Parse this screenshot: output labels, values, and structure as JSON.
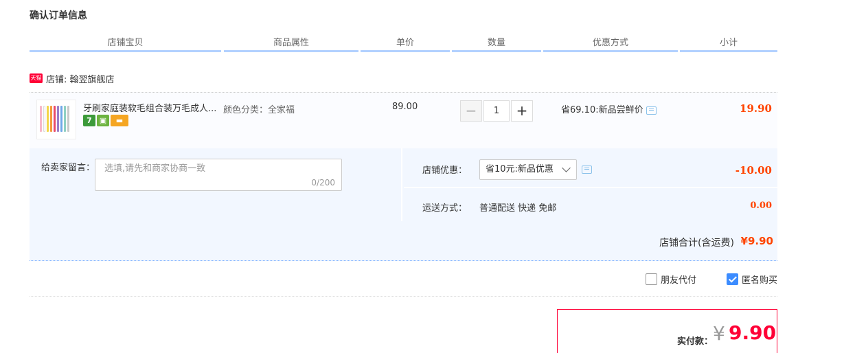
{
  "section_title": "确认订单信息",
  "columns": [
    "店铺宝贝",
    "商品属性",
    "单价",
    "数量",
    "优惠方式",
    "小计"
  ],
  "shop": {
    "badge": "天猫",
    "label": "店铺: 翰翌旗舰店"
  },
  "item": {
    "title": "牙刷家庭装软毛组合装万毛成人...",
    "icons": [
      "seven-day-return-icon",
      "shop-icon",
      "card-icon"
    ],
    "attribute": "颜色分类：全家福",
    "price": "89.00",
    "quantity": "1",
    "promo": "省69.10:新品尝鲜价",
    "subtotal": "19.90",
    "colors": {
      "accent_red": "#ff4400",
      "header_underline": "#b2d1ff",
      "panel_bg": "#f2f7ff"
    }
  },
  "memo": {
    "label": "给卖家留言：",
    "placeholder": "选填,请先和商家协商一致",
    "count": "0/200"
  },
  "coupon": {
    "label": "店铺优惠：",
    "selected": "省10元:新品优惠",
    "amount": "-10.00"
  },
  "shipping": {
    "label": "运送方式：",
    "value": "普通配送 快递 免邮",
    "amount": "0.00"
  },
  "shop_total": {
    "label": "店铺合计(含运费)",
    "value": "¥9.90"
  },
  "options": {
    "friend_pay": {
      "label": "朋友代付",
      "checked": false
    },
    "anonymous": {
      "label": "匿名购买",
      "checked": true
    }
  },
  "payment": {
    "label": "实付款：",
    "currency": "¥",
    "value": "9.90"
  }
}
